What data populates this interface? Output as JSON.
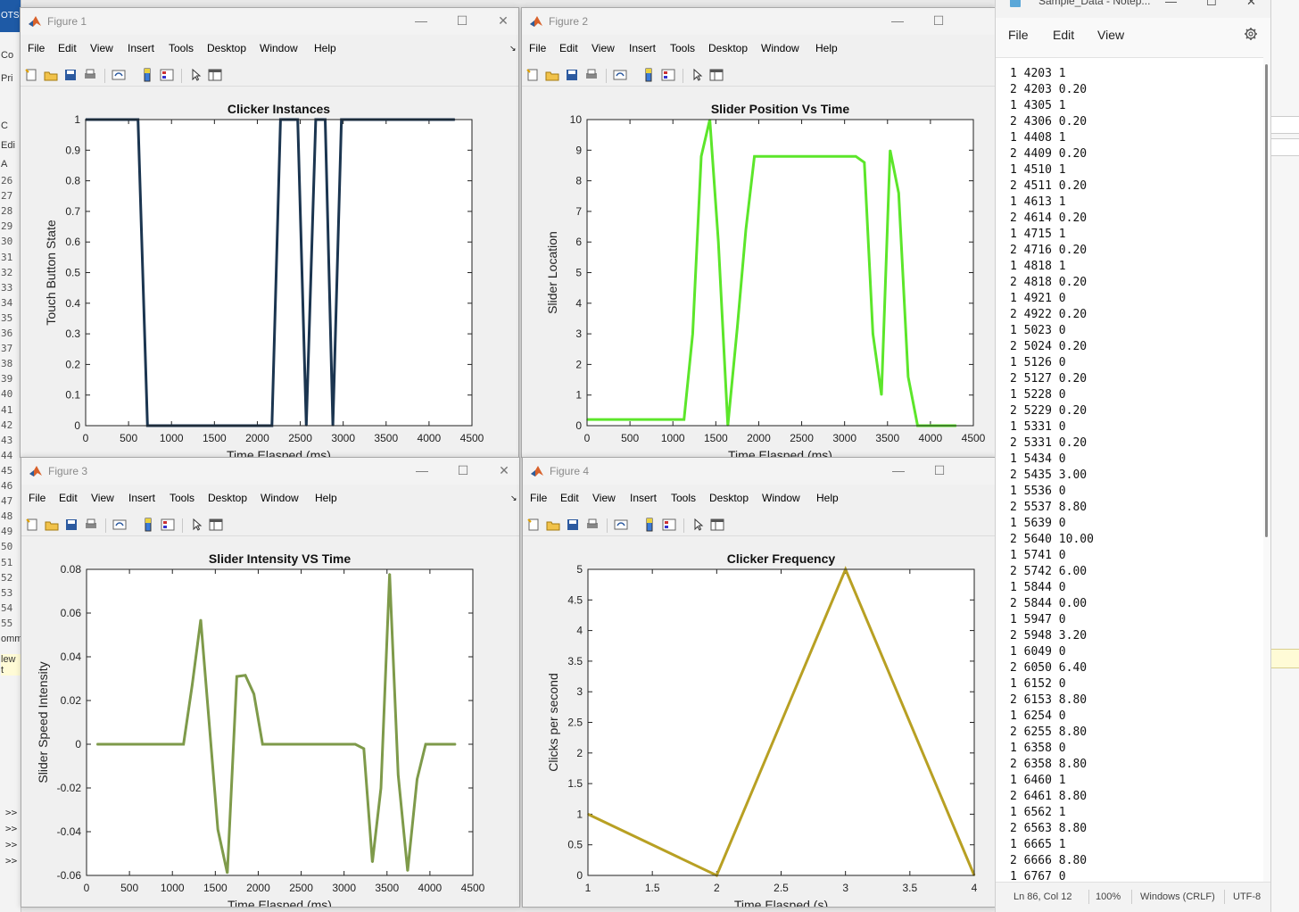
{
  "figures": [
    {
      "title": "Figure 1",
      "menu": [
        "File",
        "Edit",
        "View",
        "Insert",
        "Tools",
        "Desktop",
        "Window",
        "Help"
      ],
      "chart_data": {
        "type": "line",
        "title": "Clicker Instances",
        "xlabel": "Time Elasped (ms)",
        "ylabel": "Touch Button State",
        "xlim": [
          0,
          4500
        ],
        "ylim": [
          0,
          1
        ],
        "xticks": [
          "0",
          "500",
          "1000",
          "1500",
          "2000",
          "2500",
          "3000",
          "3500",
          "4000",
          "4500"
        ],
        "yticks": [
          "0",
          "0.1",
          "0.2",
          "0.3",
          "0.4",
          "0.5",
          "0.6",
          "0.7",
          "0.8",
          "0.9",
          "1"
        ],
        "grid": false,
        "series": [
          {
            "color": "#1b3550",
            "x": [
              0,
              610,
              720,
              2170,
              2270,
              2470,
              2570,
              2680,
              2790,
              2880,
              2980,
              4300
            ],
            "y": [
              1,
              1,
              0,
              0,
              1,
              1,
              0,
              1,
              1,
              0,
              1,
              1
            ]
          }
        ]
      }
    },
    {
      "title": "Figure 2",
      "menu": [
        "File",
        "Edit",
        "View",
        "Insert",
        "Tools",
        "Desktop",
        "Window",
        "Help"
      ],
      "chart_data": {
        "type": "line",
        "title": "Slider Position Vs Time",
        "xlabel": "Time Elasped (ms)",
        "ylabel": "Slider Location",
        "xlim": [
          0,
          4500
        ],
        "ylim": [
          0,
          10
        ],
        "xticks": [
          "0",
          "500",
          "1000",
          "1500",
          "2000",
          "2500",
          "3000",
          "3500",
          "4000",
          "4500"
        ],
        "yticks": [
          "0",
          "1",
          "2",
          "3",
          "4",
          "5",
          "6",
          "7",
          "8",
          "9",
          "10"
        ],
        "grid": false,
        "series": [
          {
            "color": "#5ce62a",
            "x": [
              0,
              1130,
              1230,
              1330,
              1430,
              1530,
              1640,
              1750,
              1850,
              1950,
              3130,
              3230,
              3330,
              3430,
              3530,
              3630,
              3740,
              3850,
              4300
            ],
            "y": [
              0.2,
              0.2,
              3,
              8.8,
              10,
              6,
              0,
              3.2,
              6.4,
              8.8,
              8.8,
              8.6,
              3,
              1,
              9,
              7.6,
              1.6,
              0,
              0
            ]
          }
        ]
      }
    },
    {
      "title": "Figure 3",
      "menu": [
        "File",
        "Edit",
        "View",
        "Insert",
        "Tools",
        "Desktop",
        "Window",
        "Help"
      ],
      "chart_data": {
        "type": "line",
        "title": "Slider Intensity VS Time",
        "xlabel": "Time Elasped (ms)",
        "ylabel": "Slider Speed Intensity",
        "xlim": [
          0,
          4500
        ],
        "ylim": [
          -0.06,
          0.08
        ],
        "xticks": [
          "0",
          "500",
          "1000",
          "1500",
          "2000",
          "2500",
          "3000",
          "3500",
          "4000",
          "4500"
        ],
        "yticks": [
          "-0.06",
          "-0.04",
          "-0.02",
          "0",
          "0.02",
          "0.04",
          "0.06",
          "0.08"
        ],
        "grid": false,
        "series": [
          {
            "color": "#7e9a4a",
            "x": [
              120,
              1130,
              1230,
              1330,
              1530,
              1640,
              1750,
              1850,
              1950,
              2050,
              3130,
              3230,
              3330,
              3430,
              3530,
              3630,
              3740,
              3850,
              3950,
              4300
            ],
            "y": [
              0,
              0,
              0.027,
              0.057,
              -0.039,
              -0.059,
              0.031,
              0.0315,
              0.023,
              0,
              0,
              -0.002,
              -0.054,
              -0.02,
              0.078,
              -0.014,
              -0.058,
              -0.016,
              0,
              0
            ]
          }
        ]
      }
    },
    {
      "title": "Figure 4",
      "menu": [
        "File",
        "Edit",
        "View",
        "Insert",
        "Tools",
        "Desktop",
        "Window",
        "Help"
      ],
      "chart_data": {
        "type": "line",
        "title": "Clicker Frequency",
        "xlabel": "Time Elasped (s)",
        "ylabel": "Clicks per second",
        "xlim": [
          1,
          4
        ],
        "ylim": [
          0,
          5
        ],
        "xticks": [
          "1",
          "1.5",
          "2",
          "2.5",
          "3",
          "3.5",
          "4"
        ],
        "yticks": [
          "0",
          "0.5",
          "1",
          "1.5",
          "2",
          "2.5",
          "3",
          "3.5",
          "4",
          "4.5",
          "5"
        ],
        "grid": false,
        "series": [
          {
            "color": "#b8a023",
            "x": [
              1,
              2,
              3,
              4
            ],
            "y": [
              1,
              0,
              5,
              0
            ]
          }
        ]
      }
    }
  ],
  "notepad": {
    "title": "Sample_Data - Notep...",
    "menu": [
      "File",
      "Edit",
      "View"
    ],
    "lines": [
      "1 4203 1",
      "2 4203 0.20",
      "1 4305 1",
      "2 4306 0.20",
      "1 4408 1",
      "2 4409 0.20",
      "1 4510 1",
      "2 4511 0.20",
      "1 4613 1",
      "2 4614 0.20",
      "1 4715 1",
      "2 4716 0.20",
      "1 4818 1",
      "2 4818 0.20",
      "1 4921 0",
      "2 4922 0.20",
      "1 5023 0",
      "2 5024 0.20",
      "1 5126 0",
      "2 5127 0.20",
      "1 5228 0",
      "2 5229 0.20",
      "1 5331 0",
      "2 5331 0.20",
      "1 5434 0",
      "2 5435 3.00",
      "1 5536 0",
      "2 5537 8.80",
      "1 5639 0",
      "2 5640 10.00",
      "1 5741 0",
      "2 5742 6.00",
      "1 5844 0",
      "2 5844 0.00",
      "1 5947 0",
      "2 5948 3.20",
      "1 6049 0",
      "2 6050 6.40",
      "1 6152 0",
      "2 6153 8.80",
      "1 6254 0",
      "2 6255 8.80",
      "1 6358 0",
      "2 6358 8.80",
      "1 6460 1",
      "2 6461 8.80",
      "1 6562 1",
      "2 6563 8.80",
      "1 6665 1",
      "2 6666 8.80",
      "1 6767 0"
    ],
    "status": {
      "position": "Ln 86, Col 12",
      "zoom": "100%",
      "eol": "Windows (CRLF)",
      "encoding": "UTF-8"
    }
  },
  "background": {
    "top_label": "OTS",
    "snippets": [
      "Co",
      "Pri",
      "C",
      "Edi",
      "A",
      "omm",
      "lew t"
    ],
    "line_numbers": [
      "26",
      "27",
      "28",
      "29",
      "30",
      "31",
      "32",
      "33",
      "34",
      "35",
      "36",
      "37",
      "38",
      "39",
      "40",
      "41",
      "42",
      "43",
      "44",
      "45",
      "46",
      "47",
      "48",
      "49",
      "50",
      "51",
      "52",
      "53",
      "54",
      "55"
    ],
    "prompts": [
      ">>",
      ">>",
      ">>",
      ">>"
    ]
  }
}
